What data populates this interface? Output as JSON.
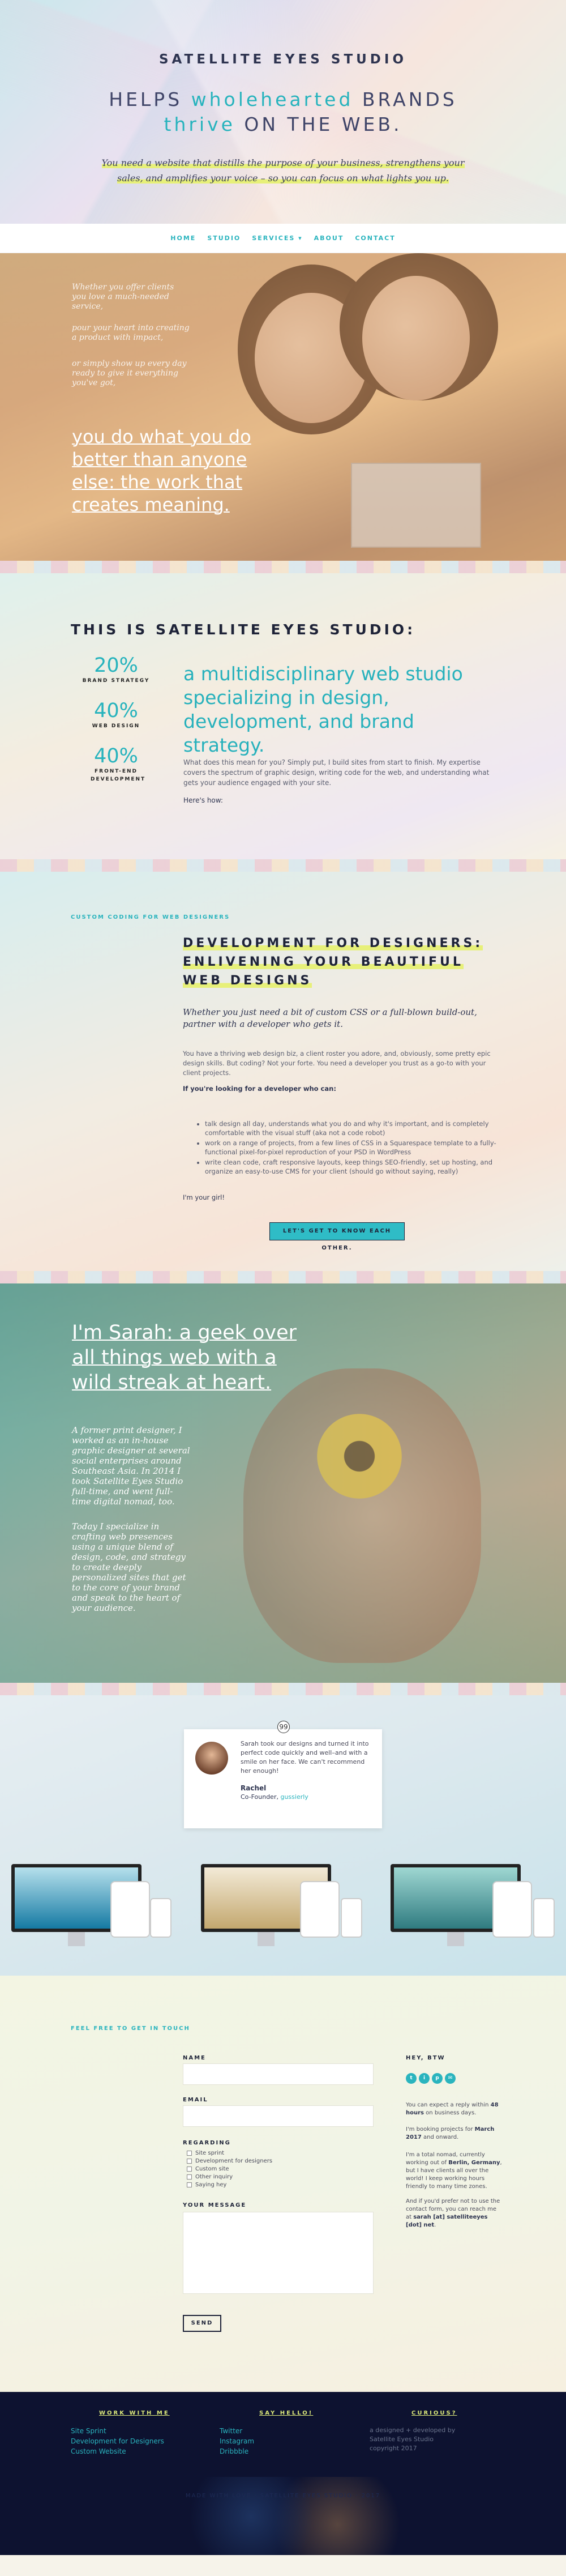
{
  "hero": {
    "brand": "SATELLITE EYES STUDIO",
    "tag_pre": "HELPS ",
    "tag_em1": "wholehearted",
    "tag_mid": " BRANDS",
    "tag_em2": "thrive",
    "tag_post": " ON THE WEB.",
    "lead1": "You need a website that distills the purpose of your business, strengthens your",
    "lead2": "sales, and amplifies your voice – so you can focus on what lights you up."
  },
  "nav": [
    "HOME",
    "STUDIO",
    "SERVICES ▾",
    "ABOUT",
    "CONTACT"
  ],
  "photo1": {
    "s1": "Whether you offer clients you love a much-needed service,",
    "s2": "pour your heart into creating a product with impact,",
    "s3": "or simply show up every day ready to give it everything you've got,",
    "big": "you do what you do better than anyone else: the work that creates meaning."
  },
  "intro": {
    "heading": "THIS IS SATELLITE EYES STUDIO:",
    "stats": [
      {
        "n": "20%",
        "l": "BRAND STRATEGY"
      },
      {
        "n": "40%",
        "l": "WEB DESIGN"
      },
      {
        "n": "40%",
        "l": "FRONT-END DEVELOPMENT"
      }
    ],
    "big": "a multidisciplinary web studio specializing in design, development, and brand strategy.",
    "p1": "What does this mean for you? Simply put, I build sites from start to finish. My expertise covers the spectrum of graphic design, writing code for the web, and understanding what gets your audience engaged with your site.",
    "p2": "Here's how:"
  },
  "dev": {
    "eyebrow": "CUSTOM CODING FOR WEB DESIGNERS",
    "h1": "DEVELOPMENT FOR DESIGNERS:",
    "h2": "ENLIVENING YOUR BEAUTIFUL",
    "h3": "WEB DESIGNS",
    "italic": "Whether you just need a bit of custom CSS or a full-blown build-out, partner with a developer who gets it.",
    "p1": "You have a thriving web design biz, a client roster you adore, and, obviously, some pretty epic design skills. But coding? Not your forte. You need a developer you trust as a go-to with your client projects.",
    "p2": "If you're looking for a developer who can:",
    "bullets": [
      "talk design all day, understands what you do and why it's important, and is completely comfortable with the visual stuff (aka not a code robot)",
      "work on a range of projects, from a few lines of CSS in a Squarespace template to a fully-functional pixel-for-pixel reproduction of your PSD in WordPress",
      "write clean code, craft responsive layouts, keep things SEO-friendly, set up hosting, and organize an easy-to-use CMS for your client (should go without saying, really)"
    ],
    "p3": "I'm your girl!",
    "button": "LET'S GET TO KNOW EACH OTHER."
  },
  "sarah": {
    "heading": "I'm Sarah: a geek over all things web with a wild streak at heart.",
    "p1": "A former print designer, I worked as an in-house graphic designer at several social enterprises around Southeast Asia. In 2014 I took Satellite Eyes Studio full-time, and went full-time digital nomad, too.",
    "p2": "Today I specialize in crafting web presences using a unique blend of design, code, and strategy to create deeply personalized sites that get to the core of your brand and speak to the heart of your audience."
  },
  "testimonial": {
    "quote_mark": "99",
    "text": "Sarah took our designs and turned it into perfect code quickly and well–and with a smile on her face. We can't recommend her enough!",
    "name": "Rachel",
    "role": "Co-Founder, ",
    "company": "gussierly"
  },
  "contact": {
    "eyebrow": "FEEL FREE TO GET IN TOUCH",
    "name_label": "NAME",
    "email_label": "EMAIL",
    "regarding_label": "REGARDING",
    "options": [
      "Site sprint",
      "Development for designers",
      "Custom site",
      "Other inquiry",
      "Saying hey"
    ],
    "message_label": "YOUR MESSAGE",
    "send": "SEND",
    "side_heading": "HEY, BTW",
    "social": [
      "t",
      "i",
      "p",
      "✉"
    ],
    "s1a": "You can expect a reply within ",
    "s1b": "48 hours",
    "s1c": " on business days.",
    "s2a": "I'm booking projects for ",
    "s2b": "March 2017",
    "s2c": " and onward.",
    "s3a": "I'm a total nomad, currently working out of ",
    "s3b": "Berlin, Germany",
    "s3c": ", but I have clients all over the world! I keep working hours friendly to many time zones.",
    "s4a": "And if you'd prefer not to use the contact form, you can reach me at ",
    "s4b": "sarah [at] satelliteeyes [dot] net",
    "s4c": "."
  },
  "footer": {
    "work_heading": "WORK WITH ME",
    "work": [
      "Site Sprint",
      "Development for Designers",
      "Custom Website"
    ],
    "hello_heading": "SAY HELLO!",
    "hello": [
      "Twitter",
      "Instagram",
      "Dribbble"
    ],
    "curious_heading": "CURIOUS?",
    "curious": [
      "a designed + developed by",
      "Satellite Eyes Studio",
      "copyright 2017"
    ],
    "copy": "MADE WITH LOVE · SATELLITE EYES STUDIO · 2017"
  },
  "colors": {
    "accent": "#26b3bd",
    "dark": "#1e2338",
    "highlight": "#e7f079"
  }
}
